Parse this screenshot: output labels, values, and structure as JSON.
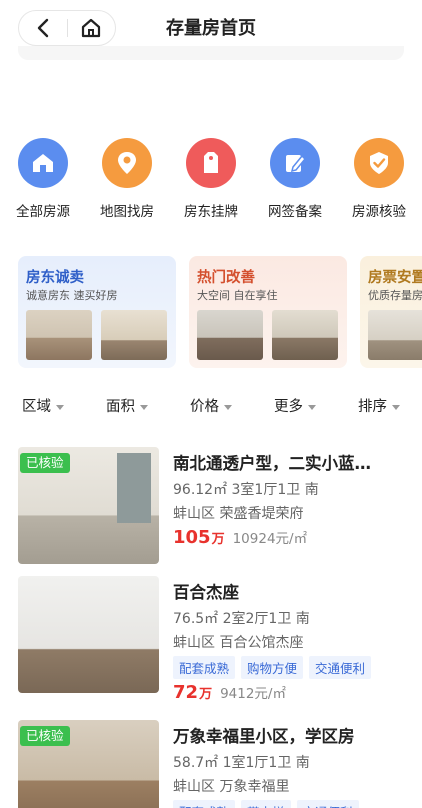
{
  "header": {
    "title": "存量房首页",
    "back_icon": "chevron-left-icon",
    "home_icon": "home-icon"
  },
  "quick_entries": [
    {
      "label": "全部房源",
      "icon": "house-icon",
      "color": "#5b8def"
    },
    {
      "label": "地图找房",
      "icon": "map-pin-icon",
      "color": "#f59b3f"
    },
    {
      "label": "房东挂牌",
      "icon": "tag-icon",
      "color": "#ef5b5b"
    },
    {
      "label": "网签备案",
      "icon": "pen-document-icon",
      "color": "#5b8def"
    },
    {
      "label": "房源核验",
      "icon": "shield-check-icon",
      "color": "#f59b3f"
    }
  ],
  "promo_cards": [
    {
      "title": "房东诚卖",
      "subtitle": "诚意房东 速买好房",
      "title_color": "#2f5fc8",
      "bg": "#eaf0fb"
    },
    {
      "title": "热门改善",
      "subtitle": "大空间 自在享住",
      "title_color": "#d4502e",
      "bg": "#fbeee8"
    },
    {
      "title": "房票安置",
      "subtitle": "优质存量房",
      "title_color": "#b07a20",
      "bg": "#fbf3e4"
    }
  ],
  "filters": [
    {
      "label": "区域"
    },
    {
      "label": "面积"
    },
    {
      "label": "价格"
    },
    {
      "label": "更多"
    },
    {
      "label": "排序"
    }
  ],
  "listings": [
    {
      "verified": "已核验",
      "title": "南北通透户型，二实小蓝…",
      "spec": "96.12㎡  3室1厅1卫  南",
      "location": "蚌山区 荣盛香堤荣府",
      "tags": [],
      "price": "105",
      "price_unit": "万",
      "unit_price": "10924元/㎡"
    },
    {
      "verified": "",
      "title": "百合杰座",
      "spec": "76.5㎡  2室2厅1卫  南",
      "location": "蚌山区 百合公馆杰座",
      "tags": [
        "配套成熟",
        "购物方便",
        "交通便利"
      ],
      "price": "72",
      "price_unit": "万",
      "unit_price": "9412元/㎡"
    },
    {
      "verified": "已核验",
      "title": "万象幸福里小区，学区房",
      "spec": "58.7㎡  1室1厅1卫  南",
      "location": "蚌山区 万象幸福里",
      "tags": [
        "配套成熟",
        "带电梯",
        "交通便利"
      ],
      "price": "",
      "price_unit": "",
      "unit_price": ""
    }
  ]
}
